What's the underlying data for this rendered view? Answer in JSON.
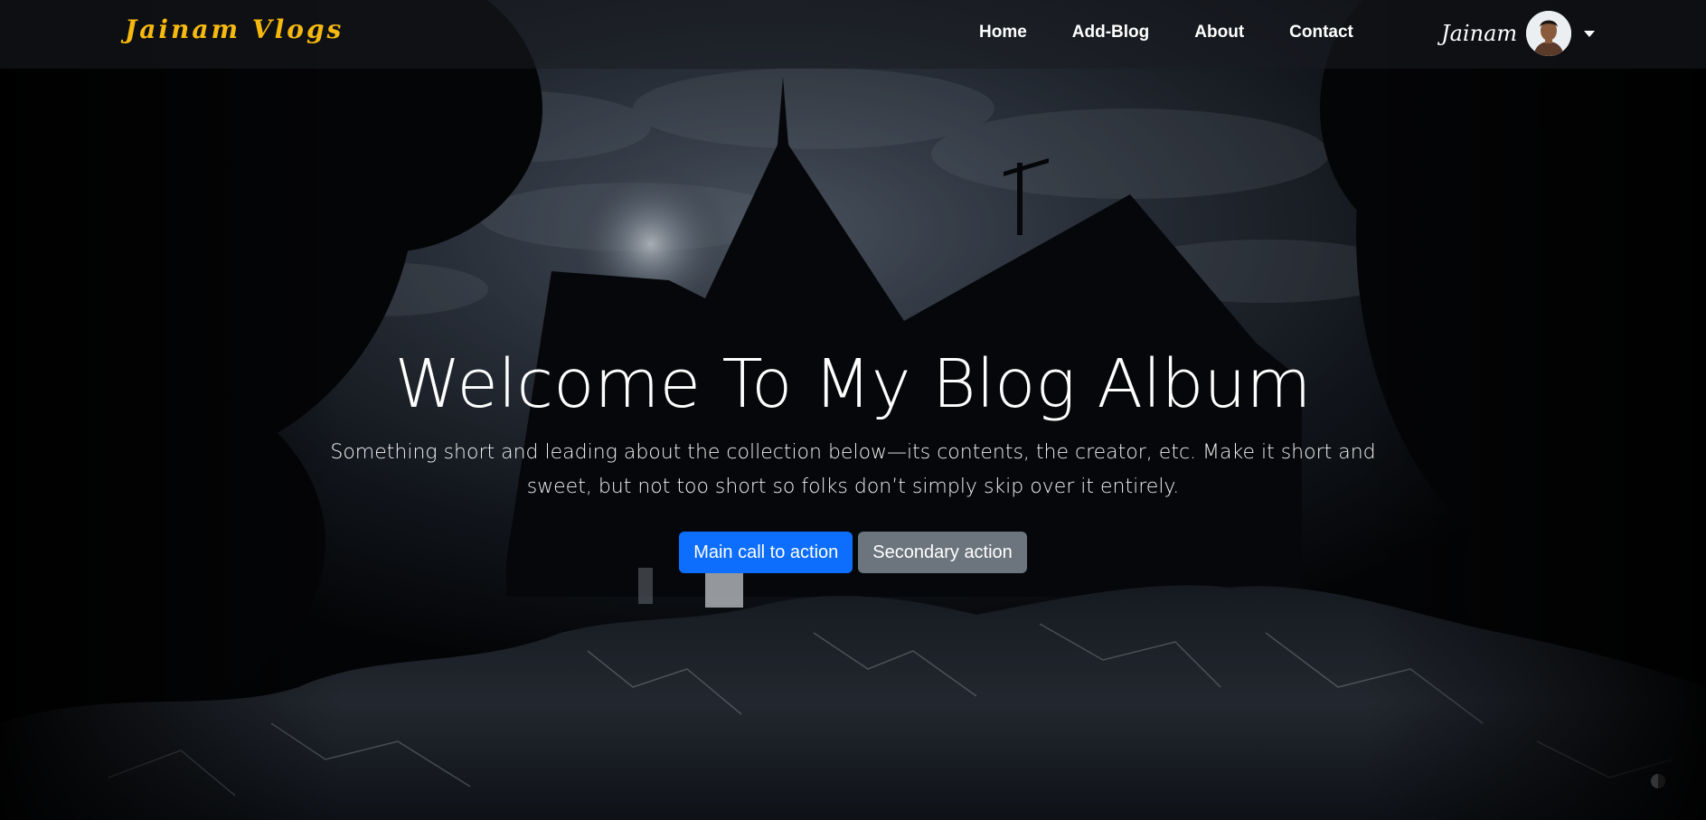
{
  "navbar": {
    "brand": "Jainam Vlogs",
    "links": [
      {
        "label": "Home"
      },
      {
        "label": "Add-Blog"
      },
      {
        "label": "About"
      },
      {
        "label": "Contact"
      }
    ],
    "user": {
      "name": "Jainam",
      "avatar_icon": "user-avatar-photo",
      "dropdown_icon": "caret-down-icon"
    }
  },
  "hero": {
    "title": "Welcome To My Blog Album",
    "lead": "Something short and leading about the collection below—its contents, the creator, etc. Make it short and sweet, but not too short so folks don’t simply skip over it entirely.",
    "primary_button": "Main call to action",
    "secondary_button": "Secondary action"
  },
  "colors": {
    "brand": "#f5b90f",
    "primary": "#0d6efd",
    "secondary": "#6c757d"
  }
}
